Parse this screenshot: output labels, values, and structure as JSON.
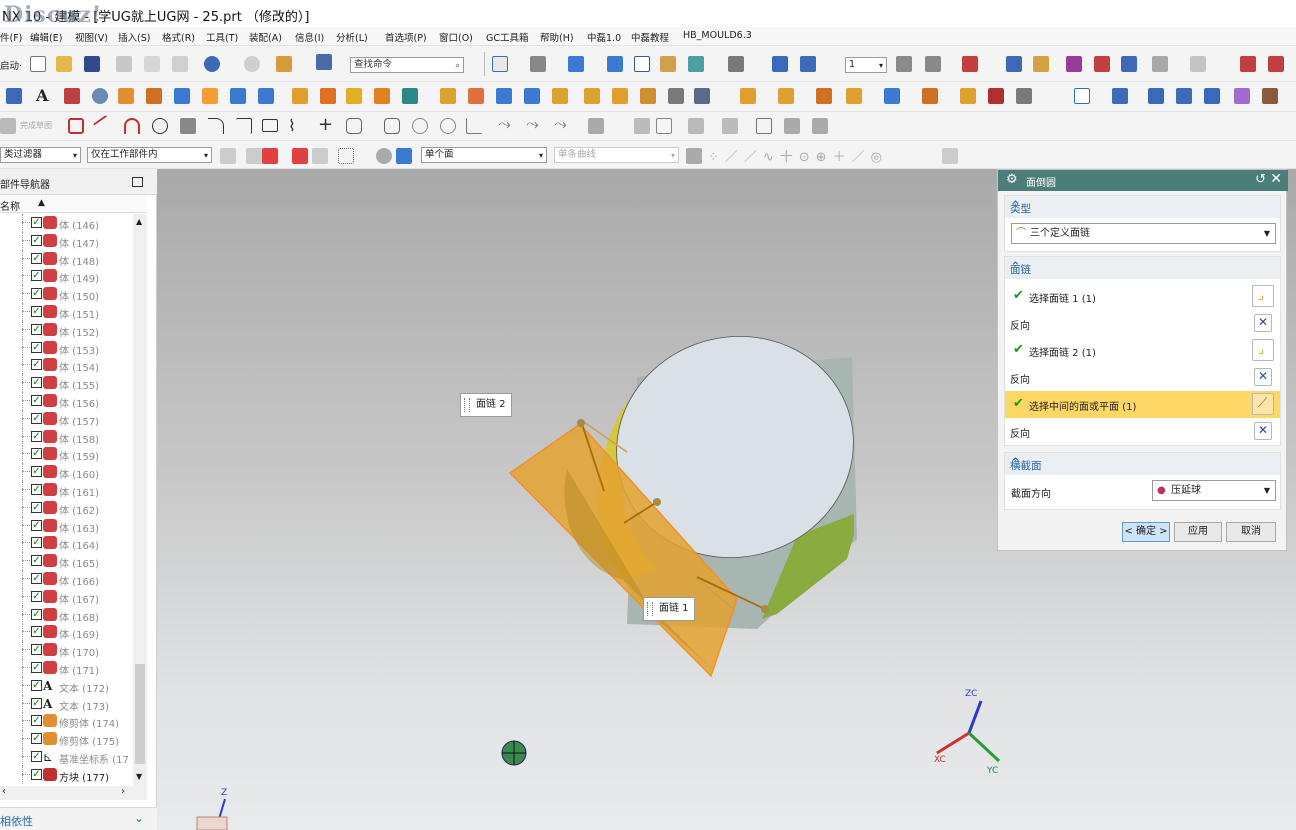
{
  "window": {
    "title": "NX 10 - 建模 - [学UG就上UG网 - 25.prt （修改的）]",
    "watermark": "Discuz!"
  },
  "menu": [
    "件(F)",
    "编辑(E)",
    "视图(V)",
    "插入(S)",
    "格式(R)",
    "工具(T)",
    "装配(A)",
    "信息(I)",
    "分析(L)",
    "首选项(P)",
    "窗口(O)",
    "GC工具箱",
    "帮助(H)",
    "中磊1.0",
    "中磊教程",
    "HB_MOULD6.3"
  ],
  "toolbar": {
    "start_label": "启动·",
    "command_search_placeholder": "查找命令",
    "layer_value": "1",
    "finish_sketch": "完成草图",
    "selection_filter": "类过滤器",
    "scope": "仅在工作部件内",
    "face_rule": "单个面",
    "curve_rule": "单条曲线"
  },
  "navigator": {
    "title": "部件导航器",
    "column": "名称",
    "items": [
      {
        "label": "体 (146)",
        "type": "body"
      },
      {
        "label": "体 (147)",
        "type": "body"
      },
      {
        "label": "体 (148)",
        "type": "body"
      },
      {
        "label": "体 (149)",
        "type": "body"
      },
      {
        "label": "体 (150)",
        "type": "body"
      },
      {
        "label": "体 (151)",
        "type": "body"
      },
      {
        "label": "体 (152)",
        "type": "body"
      },
      {
        "label": "体 (153)",
        "type": "body"
      },
      {
        "label": "体 (154)",
        "type": "body"
      },
      {
        "label": "体 (155)",
        "type": "body"
      },
      {
        "label": "体 (156)",
        "type": "body"
      },
      {
        "label": "体 (157)",
        "type": "body"
      },
      {
        "label": "体 (158)",
        "type": "body"
      },
      {
        "label": "体 (159)",
        "type": "body"
      },
      {
        "label": "体 (160)",
        "type": "body"
      },
      {
        "label": "体 (161)",
        "type": "body"
      },
      {
        "label": "体 (162)",
        "type": "body"
      },
      {
        "label": "体 (163)",
        "type": "body"
      },
      {
        "label": "体 (164)",
        "type": "body"
      },
      {
        "label": "体 (165)",
        "type": "body"
      },
      {
        "label": "体 (166)",
        "type": "body"
      },
      {
        "label": "体 (167)",
        "type": "body"
      },
      {
        "label": "体 (168)",
        "type": "body"
      },
      {
        "label": "体 (169)",
        "type": "body"
      },
      {
        "label": "体 (170)",
        "type": "body"
      },
      {
        "label": "体 (171)",
        "type": "body"
      },
      {
        "label": "文本 (172)",
        "type": "text"
      },
      {
        "label": "文本 (173)",
        "type": "text"
      },
      {
        "label": "修剪体 (174)",
        "type": "trim"
      },
      {
        "label": "修剪体 (175)",
        "type": "trim"
      },
      {
        "label": "基准坐标系 (17",
        "type": "csys"
      },
      {
        "label": "方块 (177)",
        "type": "block"
      }
    ],
    "footer": "相依性"
  },
  "viewport": {
    "label_chain1": "面链 1",
    "label_chain2": "面链 2",
    "triad": {
      "x": "XC",
      "y": "YC",
      "z": "ZC"
    },
    "mini_z": "Z"
  },
  "dialog": {
    "title": "面倒圆",
    "type_section": "类型",
    "type_value": "三个定义面链",
    "chain_section": "面链",
    "chain1": "选择面链 1 (1)",
    "reverse1": "反向",
    "chain2": "选择面链 2 (1)",
    "reverse2": "反向",
    "middle": "选择中间的面或平面 (1)",
    "reverse3": "反向",
    "cross_section": "横截面",
    "section_dir_label": "截面方向",
    "section_dir_value": "压延球",
    "ok": "< 确定 >",
    "apply": "应用",
    "cancel": "取消"
  },
  "colors": {
    "dialog_header": "#4b7d79",
    "highlight_row": "#ffd766",
    "section_title": "#2767a6",
    "selected_face": "#f2a547"
  }
}
